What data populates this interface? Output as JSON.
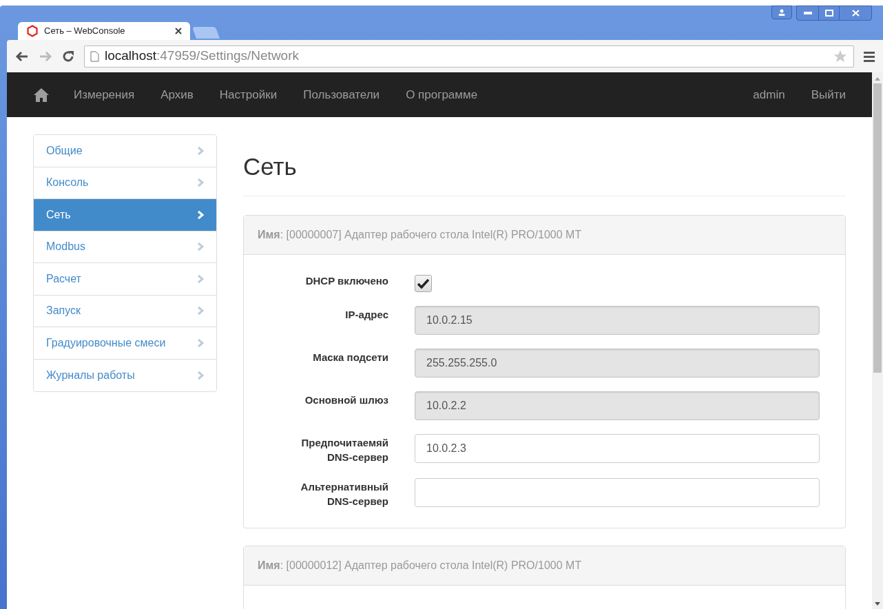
{
  "browser": {
    "tab_title": "Сеть – WebConsole",
    "url_host": "localhost",
    "url_path": ":47959/Settings/Network"
  },
  "navbar": {
    "items": [
      "Измерения",
      "Архив",
      "Настройки",
      "Пользователи",
      "О программе"
    ],
    "user": "admin",
    "logout": "Выйти"
  },
  "sidebar": {
    "items": [
      {
        "label": "Общие",
        "selected": false
      },
      {
        "label": "Консоль",
        "selected": false
      },
      {
        "label": "Сеть",
        "selected": true
      },
      {
        "label": "Modbus",
        "selected": false
      },
      {
        "label": "Расчет",
        "selected": false
      },
      {
        "label": "Запуск",
        "selected": false
      },
      {
        "label": "Градуировочные смеси",
        "selected": false
      },
      {
        "label": "Журналы работы",
        "selected": false
      }
    ]
  },
  "page_title": "Сеть",
  "adapters": [
    {
      "name": "**Имя**: [00000007] Адаптер рабочего стола Intel(R) PRO/1000 MT",
      "fields": [
        {
          "kind": "checkbox",
          "label": "DHCP включено",
          "checked": true
        },
        {
          "kind": "text",
          "label": "IP-адрес",
          "value": "10.0.2.15",
          "disabled": true
        },
        {
          "kind": "text",
          "label": "Маска подсети",
          "value": "255.255.255.0",
          "disabled": true
        },
        {
          "kind": "text",
          "label": "Основной шлюз",
          "value": "10.0.2.2",
          "disabled": true
        },
        {
          "kind": "text",
          "label": "Предпочитаемяй DNS-сервер",
          "value": "10.0.2.3",
          "disabled": false
        },
        {
          "kind": "text",
          "label": "Альтернативный DNS-сервер",
          "disabled": false
        }
      ]
    },
    {
      "name": "**Имя**: [00000012] Адаптер рабочего стола Intel(R) PRO/1000 MT"
    }
  ]
}
